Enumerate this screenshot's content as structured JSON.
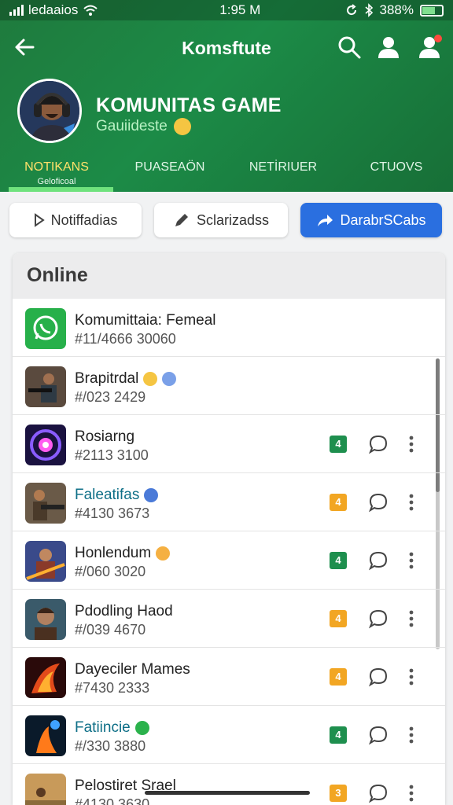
{
  "status_bar": {
    "carrier": "ledaaios",
    "time": "1:95 M",
    "battery": "388%"
  },
  "app_bar": {
    "title": "Komsftute",
    "icons": [
      "back-arrow-icon",
      "search-icon",
      "user-icon",
      "notification-user-icon"
    ]
  },
  "profile": {
    "name": "KOMUNITAS GAME",
    "subtitle": "Gauiideste"
  },
  "tabs": [
    {
      "label": "NOTIKANS",
      "sub": "Geloficoal",
      "active": true
    },
    {
      "label": "PUASEAÖN",
      "sub": "",
      "active": false
    },
    {
      "label": "NETİRIUER",
      "sub": "",
      "active": false
    },
    {
      "label": "CTUOVS",
      "sub": "",
      "active": false
    }
  ],
  "actions": [
    {
      "label": "Notiffadias",
      "icon": "play-outline-icon",
      "primary": false
    },
    {
      "label": "Sclarizadss",
      "icon": "pen-icon",
      "primary": false
    },
    {
      "label": "DarabrSCabs",
      "icon": "share-arrow-icon",
      "primary": true
    }
  ],
  "panel": {
    "title": "Online"
  },
  "list": [
    {
      "name": "Komumittaia: Femeal",
      "id": "#11/4666 30060",
      "style": "normal",
      "badge": "",
      "badge_color": "",
      "thumb": "whatsapp"
    },
    {
      "name": "Brapitrdal",
      "id": "#/023 2429",
      "style": "normal",
      "badge": "",
      "badge_color": "",
      "thumb": "soldier"
    },
    {
      "name": "Rosiarng",
      "id": "#2113 3100",
      "style": "normal",
      "badge": "4",
      "badge_color": "#1e8f4e",
      "thumb": "orb"
    },
    {
      "name": "Faleatifas",
      "id": "#4130 3673",
      "style": "teal",
      "badge": "4",
      "badge_color": "#f2a623",
      "thumb": "gunner"
    },
    {
      "name": "Honlendum",
      "id": "#/060 3020",
      "style": "normal",
      "badge": "4",
      "badge_color": "#1e8f4e",
      "thumb": "hero"
    },
    {
      "name": "Pdodling Haod",
      "id": "#/039 4670",
      "style": "normal",
      "badge": "4",
      "badge_color": "#f2a623",
      "thumb": "portrait"
    },
    {
      "name": "Dayeciler Mames",
      "id": "#7430 2333",
      "style": "normal",
      "badge": "4",
      "badge_color": "#f2a623",
      "thumb": "fire"
    },
    {
      "name": "Fatiincie",
      "id": "#/330 3880",
      "style": "teal",
      "badge": "4",
      "badge_color": "#1e8f4e",
      "thumb": "flame"
    },
    {
      "name": "Pelostiret Srael",
      "id": "#4130 3630",
      "style": "normal",
      "badge": "3",
      "badge_color": "#f2a623",
      "thumb": "desert"
    }
  ]
}
